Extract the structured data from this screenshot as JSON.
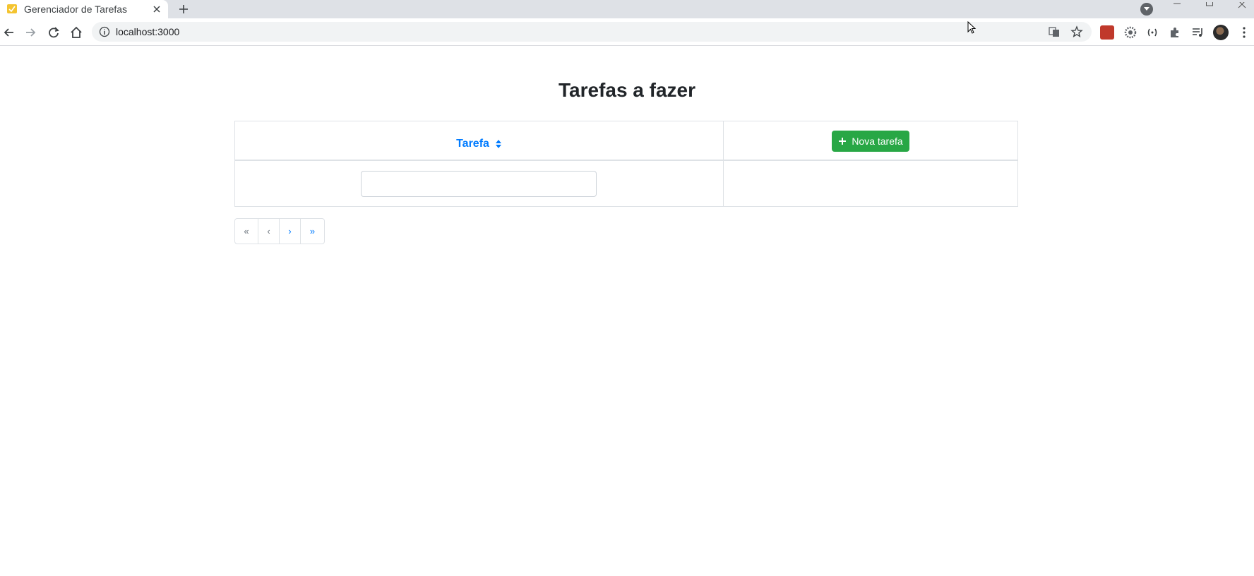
{
  "browser": {
    "tab_title": "Gerenciador de Tarefas",
    "url": "localhost:3000"
  },
  "page": {
    "title": "Tarefas a fazer",
    "table": {
      "column_task_label": "Tarefa",
      "new_task_button_label": "Nova tarefa",
      "filter_value": "",
      "filter_placeholder": ""
    },
    "pagination": {
      "first": "«",
      "prev": "‹",
      "next": "›",
      "last": "»"
    }
  },
  "colors": {
    "primary": "#007bff",
    "success": "#28a745",
    "border": "#dee2e6"
  }
}
